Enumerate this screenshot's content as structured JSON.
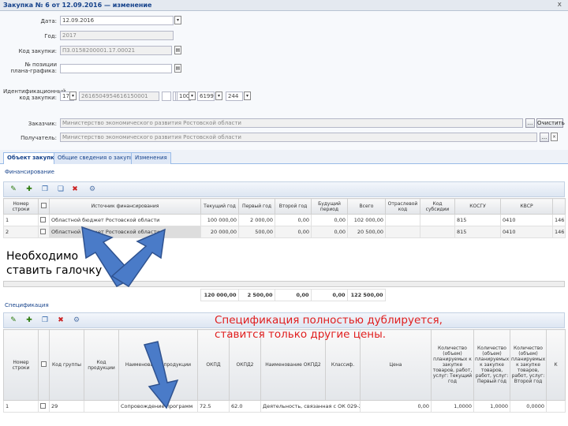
{
  "window": {
    "title": "Закупка № 6 от 12.09.2016 — изменение",
    "close_glyph": "x"
  },
  "form": {
    "date": {
      "label": "Дата:",
      "value": "12.09.2016"
    },
    "year": {
      "label": "Год:",
      "value": "2017"
    },
    "purchase_code": {
      "label": "Код закупки:",
      "value": "П3.0158200001.17.00021"
    },
    "plan_position": {
      "label": "№ позиции плана-графика:",
      "value": ""
    },
    "ikz": {
      "label": "Идентификационный код закупки:",
      "parts": [
        "17",
        "2616504954616150001",
        "",
        "",
        "",
        "100",
        "",
        "",
        "6199",
        "",
        "244"
      ]
    },
    "customer": {
      "label": "Заказчик:",
      "value": "Министерство экономического развития Ростовской области",
      "clear_label": "Очистить"
    },
    "recipient": {
      "label": "Получатель:",
      "value": "Министерство экономического развития Ростовской области"
    },
    "ellipsis": "..."
  },
  "tabs": [
    "Объект закупки",
    "Общие сведения о закупке",
    "Изменения"
  ],
  "financing": {
    "title": "Финансирование",
    "columns": [
      "Номер строки",
      "",
      "Источник финансирования",
      "Текущий год",
      "Первый год",
      "Второй год",
      "Будущий период",
      "Всего",
      "Отраслевой код",
      "Код субсидии",
      "КОСГУ",
      "КВСР"
    ],
    "rows": [
      {
        "n": "1",
        "source": "Областной бюджет Ростовской области",
        "cur": "100 000,00",
        "y1": "2 000,00",
        "y2": "0,00",
        "fut": "0,00",
        "total": "102 000,00",
        "otr": "",
        "subs": "",
        "kosgu": "815",
        "kvsr": "0410",
        "extra": "146"
      },
      {
        "n": "2",
        "source": "Областной бюджет Ростовской области",
        "cur": "20 000,00",
        "y1": "500,00",
        "y2": "0,00",
        "fut": "0,00",
        "total": "20 500,00",
        "otr": "",
        "subs": "",
        "kosgu": "815",
        "kvsr": "0410",
        "extra": "146"
      }
    ],
    "totals": {
      "cur": "120 000,00",
      "y1": "2 500,00",
      "y2": "0,00",
      "fut": "0,00",
      "total": "122 500,00"
    }
  },
  "spec": {
    "title": "Спецификация",
    "columns": [
      "Номер строки",
      "",
      "Код группы",
      "Код продукции",
      "Наименование продукции",
      "ОКПД",
      "ОКПД2",
      "Наименование ОКПД2",
      "Классиф.",
      "Цена",
      "Количество (объем) планируемых к закупке товаров, работ, услуг: Текущий год",
      "Количество (объем) планируемых к закупке товаров, работ, услуг: Первый год",
      "Количество (объем) планируемых к закупке товаров, работ, услуг: Второй год",
      "К"
    ],
    "rows": [
      {
        "n": "1",
        "group": "29",
        "prod_code": "",
        "name": "Сопровождение программ",
        "okpd": "72.5",
        "okpd2": "62.0",
        "okpd2_name": "Деятельность, связанная с ОК 029-2",
        "price": "0,00",
        "q_cur": "1,0000",
        "q_y1": "1,0000",
        "q_y2": "0,0000"
      }
    ]
  },
  "annotations": {
    "left_note": "Необходимо ставить галочку",
    "red_note": "Спецификация полностью дублируется, ставится только другие цены."
  },
  "colors": {
    "accent": "#15428b",
    "arrow_fill": "#4a7bc8",
    "arrow_stroke": "#2f528f",
    "red": "#e01e1e"
  }
}
